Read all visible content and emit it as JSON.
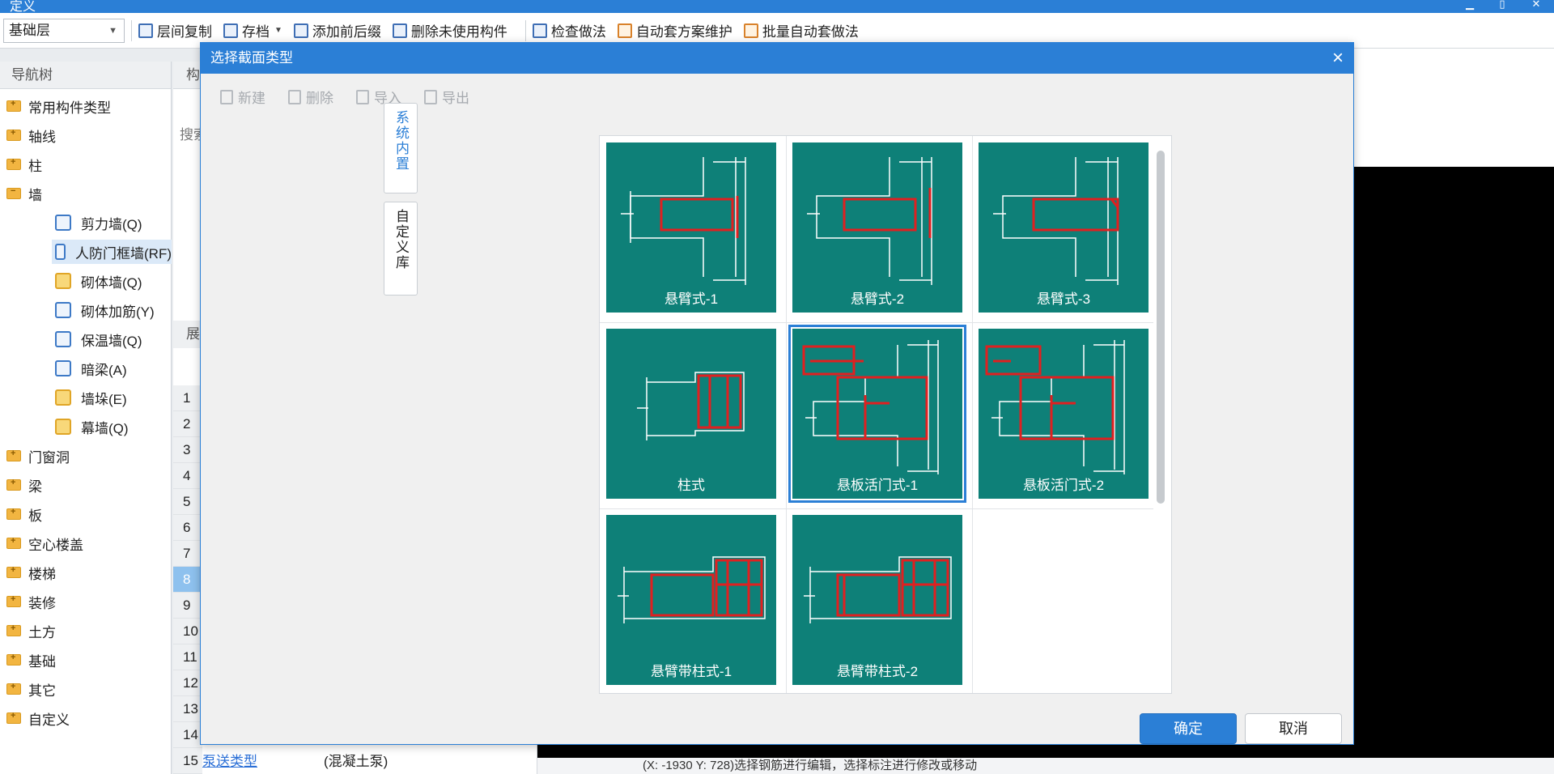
{
  "window": {
    "title": "定义"
  },
  "toolbar": {
    "floor_value": "基础层",
    "buttons": [
      {
        "label": "层间复制"
      },
      {
        "label": "存档"
      },
      {
        "label": "添加前后缀"
      },
      {
        "label": "删除未使用构件"
      },
      {
        "label": "检查做法"
      },
      {
        "label": "自动套方案维护"
      },
      {
        "label": "批量自动套做法"
      }
    ]
  },
  "nav": {
    "header": "导航树",
    "items": [
      {
        "label": "常用构件类型"
      },
      {
        "label": "轴线"
      },
      {
        "label": "柱"
      },
      {
        "label": "墙"
      },
      {
        "label": "剪力墙(Q)"
      },
      {
        "label": "人防门框墙(RF)"
      },
      {
        "label": "砌体墙(Q)"
      },
      {
        "label": "砌体加筋(Y)"
      },
      {
        "label": "保温墙(Q)"
      },
      {
        "label": "暗梁(A)"
      },
      {
        "label": "墙垛(E)"
      },
      {
        "label": "幕墙(Q)"
      },
      {
        "label": "门窗洞"
      },
      {
        "label": "梁"
      },
      {
        "label": "板"
      },
      {
        "label": "空心楼盖"
      },
      {
        "label": "楼梯"
      },
      {
        "label": "装修"
      },
      {
        "label": "土方"
      },
      {
        "label": "基础"
      },
      {
        "label": "其它"
      },
      {
        "label": "自定义"
      }
    ]
  },
  "mid": {
    "header": "构",
    "search": "搜索",
    "props_header": "展",
    "rows": [
      "1",
      "2",
      "3",
      "4",
      "5",
      "6",
      "7",
      "8",
      "9",
      "10",
      "11",
      "12",
      "13",
      "14",
      "15"
    ],
    "last_row_label": "泵送类型",
    "last_row_value": "(混凝土泵)"
  },
  "status_text": "(X: -1930 Y: 728)选择钢筋进行编辑，选择标注进行修改或移动",
  "modal": {
    "title": "选择截面类型",
    "tools": [
      {
        "label": "新建"
      },
      {
        "label": "删除"
      },
      {
        "label": "导入"
      },
      {
        "label": "导出"
      }
    ],
    "tab_system": "系统内置",
    "tab_custom": "自定义库",
    "sections": [
      {
        "label": "悬臂式-1"
      },
      {
        "label": "悬臂式-2"
      },
      {
        "label": "悬臂式-3"
      },
      {
        "label": "柱式"
      },
      {
        "label": "悬板活门式-1"
      },
      {
        "label": "悬板活门式-2"
      },
      {
        "label": "悬臂带柱式-1"
      },
      {
        "label": "悬臂带柱式-2"
      }
    ],
    "selected_index": 4,
    "ok_label": "确定",
    "cancel_label": "取消"
  },
  "colors": {
    "accent": "#2b7fd6",
    "tile": "#0e8078",
    "rebar": "#e02020"
  }
}
